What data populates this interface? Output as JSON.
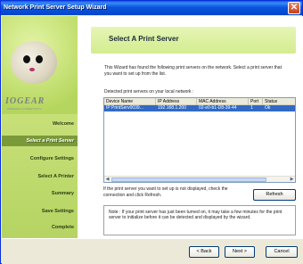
{
  "window": {
    "title": "Network Print Server Setup Wizard"
  },
  "sidebar": {
    "logo": "IOGEAR",
    "logo_sub": "WIRELESS CONNECTIVITY",
    "steps": [
      {
        "label": "Welcome",
        "active": false
      },
      {
        "label": "Select a Print Server",
        "active": true
      },
      {
        "label": "Configure Settings",
        "active": false
      },
      {
        "label": "Select A Printer",
        "active": false
      },
      {
        "label": "Summary",
        "active": false
      },
      {
        "label": "Save Settings",
        "active": false
      },
      {
        "label": "Complete",
        "active": false
      }
    ]
  },
  "main": {
    "heading": "Select A Print Server",
    "description": "This Wizard has found the following print servers on the network. Select a print server that you want to set up from the list.",
    "list_label": "Detected print servers on your local network :",
    "columns": [
      "Device Name",
      "IP Address",
      "MAC Address",
      "Port",
      "Status"
    ],
    "rows": [
      {
        "device_name": "IP PrintServ0039...",
        "ip_address": "192.168.1.200",
        "mac_address": "02-e0-b1-D8-39-44",
        "port": "1",
        "status": "Ok"
      }
    ],
    "refresh_text": "If the print server you want to set up is not displayed, check the connection and click Refresh.",
    "refresh_button": "Refresh",
    "note": "Note : If your print server has just been turned on, it may take a few minutes for the print server to initialize before it can be detected and displayed by the wizard."
  },
  "footer": {
    "back_label": "< Back",
    "next_label": "Next >",
    "cancel_label": "Cancel"
  },
  "colors": {
    "title_bar": "#0a58e3",
    "sidebar_green": "#b5d463",
    "active_step": "#7a9a3a",
    "header_band": "#d4ec8f",
    "selection": "#316ac5"
  },
  "icons": [
    "close-icon",
    "scroll-left-icon",
    "scroll-right-icon",
    "bunny-mascot-icon"
  ]
}
